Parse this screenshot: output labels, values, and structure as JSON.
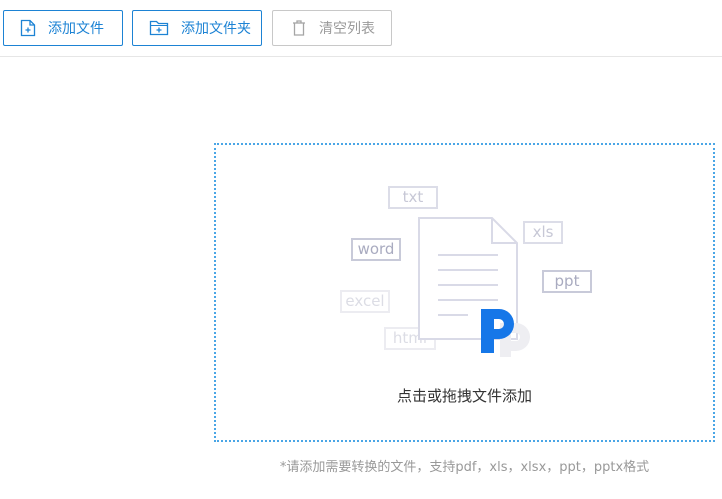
{
  "toolbar": {
    "add_file_label": "添加文件",
    "add_folder_label": "添加文件夹",
    "clear_list_label": "清空列表"
  },
  "dropzone": {
    "instruction": "点击或拖拽文件添加",
    "file_tags": [
      "txt",
      "xls",
      "word",
      "ppt",
      "excel",
      "html"
    ]
  },
  "hint": "*请添加需要转换的文件，支持pdf，xls，xlsx，ppt，pptx格式",
  "colors": {
    "accent": "#1d83d4",
    "dropzone_border": "#4aa6e6",
    "disabled": "#9a9a9a"
  }
}
